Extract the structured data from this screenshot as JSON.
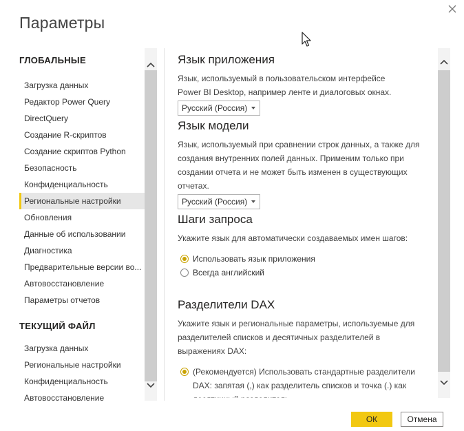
{
  "dialog": {
    "title": "Параметры"
  },
  "sidebar": {
    "global_header": "ГЛОБАЛЬНЫЕ",
    "global_items": [
      "Загрузка данных",
      "Редактор Power Query",
      "DirectQuery",
      "Создание R-скриптов",
      "Создание скриптов Python",
      "Безопасность",
      "Конфиденциальность",
      "Региональные настройки",
      "Обновления",
      "Данные об использовании",
      "Диагностика",
      "Предварительные версии во...",
      "Автовосстановление",
      "Параметры отчетов"
    ],
    "selected_item": "Региональные настройки",
    "current_header": "ТЕКУЩИЙ ФАЙЛ",
    "current_items": [
      "Загрузка данных",
      "Региональные настройки",
      "Конфиденциальность",
      "Автовосстановление"
    ]
  },
  "content": {
    "app_lang": {
      "title": "Язык приложения",
      "desc_line1": "Язык, используемый в пользовательском интерфейсе",
      "desc_line2": "Power BI Desktop, например ленте и диалоговых окнах.",
      "value": "Русский (Россия)"
    },
    "model_lang": {
      "title": "Язык модели",
      "desc_lines": [
        "Язык, используемый при сравнении строк данных, а также для",
        "создания внутренних полей данных. Применим только при",
        "создании отчета и не может быть изменен в существующих",
        "отчетах."
      ],
      "value": "Русский (Россия)"
    },
    "query_steps": {
      "title": "Шаги запроса",
      "desc": "Укажите язык для автоматически создаваемых имен шагов:",
      "options": [
        "Использовать язык приложения",
        "Всегда английский"
      ],
      "selected": 0
    },
    "dax": {
      "title": "Разделители DAX",
      "desc_lines": [
        "Укажите язык и региональные параметры, используемые для",
        "разделителей списков и десятичных разделителей в",
        "выражениях DAX:"
      ],
      "option_lines": [
        "(Рекомендуется) Использовать стандартные разделители",
        "DAX: запятая (,) как разделитель списков и точка (.) как",
        "десятичный разделитель."
      ]
    }
  },
  "buttons": {
    "ok": "ОК",
    "cancel": "Отмена"
  },
  "colors": {
    "accent": "#f2c811",
    "selected_bg": "#e6e6e6"
  }
}
